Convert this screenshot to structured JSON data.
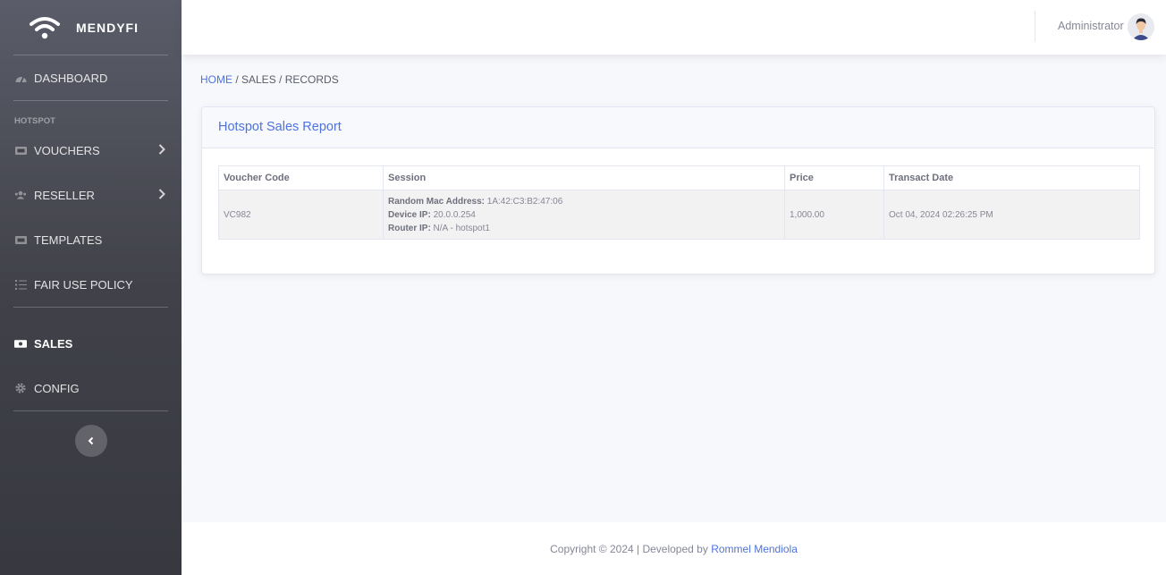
{
  "brand": {
    "name": "MENDYFI",
    "icon": "wifi-icon"
  },
  "sidebar": {
    "dashboard": {
      "label": "DASHBOARD",
      "icon": "tachometer-icon"
    },
    "section_hotspot": "HOTSPOT",
    "vouchers": {
      "label": "VOUCHERS",
      "icon": "ticket-icon"
    },
    "reseller": {
      "label": "RESELLER",
      "icon": "users-icon"
    },
    "templates": {
      "label": "TEMPLATES",
      "icon": "ticket-icon"
    },
    "fair_use": {
      "label": "FAIR USE POLICY",
      "icon": "list-icon"
    },
    "sales": {
      "label": "SALES",
      "icon": "money-icon",
      "active": true
    },
    "config": {
      "label": "CONFIG",
      "icon": "gear-icon"
    }
  },
  "topbar": {
    "user_name": "Administrator"
  },
  "breadcrumb": {
    "home": "HOME",
    "rest": " / SALES / RECORDS"
  },
  "card": {
    "title": "Hotspot Sales Report",
    "columns": [
      "Voucher Code",
      "Session",
      "Price",
      "Transact Date"
    ],
    "rows": [
      {
        "voucher": "VC982",
        "mac_label": "Random Mac Address:",
        "mac": " 1A:42:C3:B2:47:06",
        "ip_label": "Device IP:",
        "ip": " 20.0.0.254",
        "router_label": "Router IP:",
        "router": " N/A - hotspot1",
        "price": "1,000.00",
        "date": "Oct 04, 2024 02:26:25 PM"
      }
    ]
  },
  "footer": {
    "text": "Copyright © 2024 | Developed by ",
    "author": "Rommel Mendiola"
  },
  "colors": {
    "accent": "#4e73df",
    "sidebar": "#414249"
  }
}
